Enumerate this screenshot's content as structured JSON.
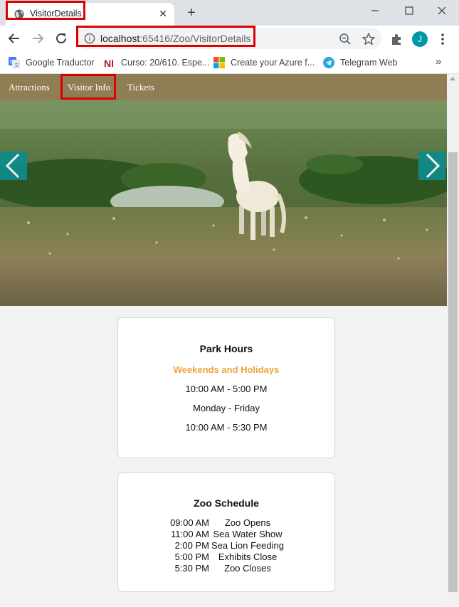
{
  "browser": {
    "tab_title": "VisitorDetails",
    "new_tab_label": "+",
    "url_host": "localhost",
    "url_rest": ":65416/Zoo/VisitorDetails",
    "profile_initial": "J",
    "bookmarks": [
      {
        "label": "Google Traductor",
        "icon": "google-translate-icon"
      },
      {
        "label": "Curso: 20/610. Espe...",
        "icon": "ni-icon"
      },
      {
        "label": "Create your Azure f...",
        "icon": "microsoft-icon"
      },
      {
        "label": "Telegram Web",
        "icon": "telegram-icon"
      }
    ],
    "bookmarks_more": "»"
  },
  "site": {
    "nav": [
      "Attractions",
      "Visitor Info",
      "Tickets"
    ],
    "nav_color": "#8f7d53",
    "carousel_color": "#0e8c8c"
  },
  "park_hours": {
    "title": "Park Hours",
    "subtitle": "Weekends and Holidays",
    "weekend_hours": "10:00 AM - 5:00 PM",
    "weekday_label": "Monday - Friday",
    "weekday_hours": "10:00 AM - 5:30 PM",
    "accent_color": "#f0a13c"
  },
  "zoo_schedule": {
    "title": "Zoo Schedule",
    "items": [
      {
        "time": "09:00 AM",
        "event": "Zoo Opens"
      },
      {
        "time": "11:00 AM",
        "event": "Sea Water Show"
      },
      {
        "time": "2:00 PM",
        "event": "Sea Lion Feeding"
      },
      {
        "time": "5:00 PM",
        "event": "Exhibits Close"
      },
      {
        "time": "5:30 PM",
        "event": "Zoo Closes"
      }
    ]
  },
  "annotation_color": "#e00000"
}
